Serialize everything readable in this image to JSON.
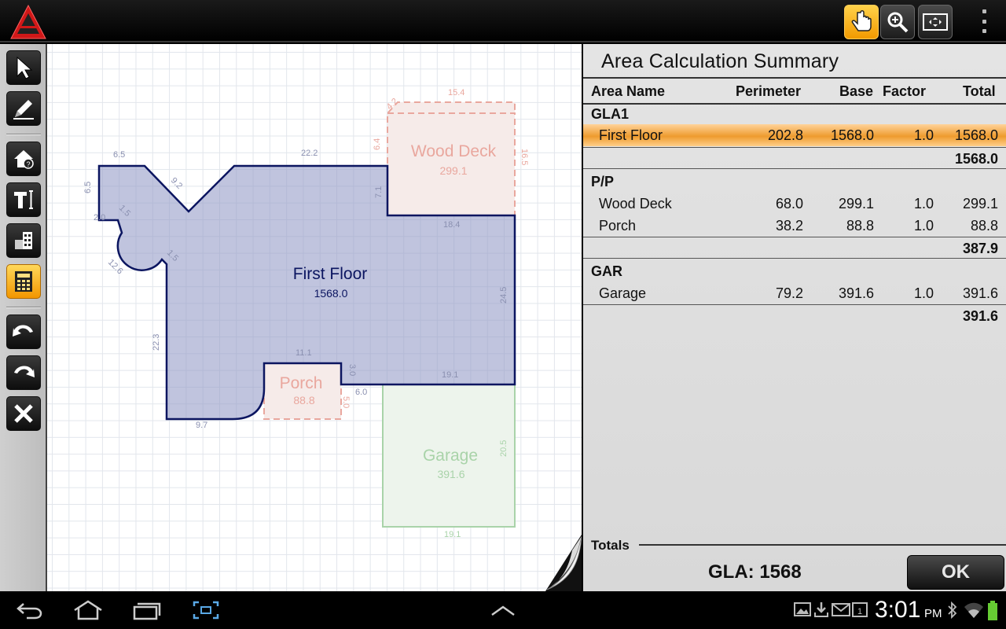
{
  "canvas": {
    "areas": [
      {
        "name": "First Floor",
        "value": "1568.0"
      },
      {
        "name": "Wood Deck",
        "value": "299.1"
      },
      {
        "name": "Porch",
        "value": "88.8"
      },
      {
        "name": "Garage",
        "value": "391.6"
      }
    ],
    "dimensions": [
      "15.4",
      "4.2",
      "6.4",
      "16.5",
      "22.2",
      "6.5",
      "9.2",
      "6.5",
      "7.1",
      "2.0",
      "1.5",
      "18.4",
      "12.6",
      "1.5",
      "24.5",
      "22.3",
      "11.1",
      "3.0",
      "19.1",
      "6.0",
      "5.0",
      "9.7",
      "20.5",
      "19.1"
    ]
  },
  "panel": {
    "title": "Area Calculation Summary",
    "headers": {
      "name": "Area Name",
      "perimeter": "Perimeter",
      "base": "Base",
      "factor": "Factor",
      "total": "Total"
    },
    "groups": [
      {
        "label": "GLA1",
        "rows": [
          {
            "name": "First Floor",
            "perimeter": "202.8",
            "base": "1568.0",
            "factor": "1.0",
            "total": "1568.0"
          }
        ],
        "subtotal": "1568.0"
      },
      {
        "label": "P/P",
        "rows": [
          {
            "name": "Wood Deck",
            "perimeter": "68.0",
            "base": "299.1",
            "factor": "1.0",
            "total": "299.1"
          },
          {
            "name": "Porch",
            "perimeter": "38.2",
            "base": "88.8",
            "factor": "1.0",
            "total": "88.8"
          }
        ],
        "subtotal": "387.9"
      },
      {
        "label": "GAR",
        "rows": [
          {
            "name": "Garage",
            "perimeter": "79.2",
            "base": "391.6",
            "factor": "1.0",
            "total": "391.6"
          }
        ],
        "subtotal": "391.6"
      }
    ],
    "totals_label": "Totals",
    "gla": "GLA: 1568",
    "ok_label": "OK"
  },
  "status": {
    "time": "3:01",
    "ampm": "PM"
  },
  "colors": {
    "accent": "#f29a00",
    "first_floor_fill": "#c2c6df",
    "first_floor_stroke": "#0b1560",
    "deck": "#e8a9a0",
    "garage": "#a9d3a9"
  },
  "icons": {
    "topbar": [
      "app-logo-icon",
      "pan-hand-icon",
      "zoom-icon",
      "fit-screen-icon",
      "overflow-menu-icon"
    ],
    "toolbar": [
      "select-arrow-icon",
      "pencil-icon",
      "house-info-icon",
      "text-tool-icon",
      "building-icon",
      "calculator-icon",
      "undo-icon",
      "redo-icon",
      "close-icon"
    ],
    "system": [
      "back-icon",
      "home-icon",
      "recent-apps-icon",
      "screenshot-icon",
      "up-arrow-icon",
      "gallery-icon",
      "download-icon",
      "gmail-icon",
      "calendar-icon",
      "bluetooth-icon",
      "wifi-icon",
      "battery-icon"
    ]
  }
}
